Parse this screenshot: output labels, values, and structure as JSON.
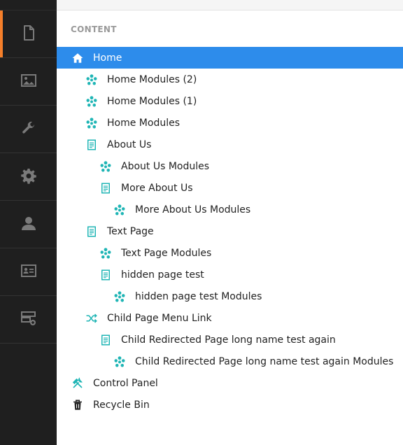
{
  "sidebar": {
    "items": [
      {
        "icon": "document-icon",
        "active": true
      },
      {
        "icon": "image-icon",
        "active": false
      },
      {
        "icon": "wrench-icon",
        "active": false
      },
      {
        "icon": "gear-icon",
        "active": false
      },
      {
        "icon": "user-icon",
        "active": false
      },
      {
        "icon": "contact-card-icon",
        "active": false
      },
      {
        "icon": "server-add-icon",
        "active": false
      }
    ]
  },
  "content": {
    "header": "CONTENT",
    "tree": [
      {
        "label": "Home",
        "icon": "home-icon",
        "depth": 0,
        "selected": true
      },
      {
        "label": "Home Modules (2)",
        "icon": "modules-icon",
        "depth": 1
      },
      {
        "label": "Home Modules (1)",
        "icon": "modules-icon",
        "depth": 1
      },
      {
        "label": "Home Modules",
        "icon": "modules-icon",
        "depth": 1
      },
      {
        "label": "About Us",
        "icon": "page-icon",
        "depth": 1
      },
      {
        "label": "About Us Modules",
        "icon": "modules-icon",
        "depth": 2
      },
      {
        "label": "More About Us",
        "icon": "page-icon",
        "depth": 2
      },
      {
        "label": "More About Us Modules",
        "icon": "modules-icon",
        "depth": 3
      },
      {
        "label": "Text Page",
        "icon": "page-icon",
        "depth": 1
      },
      {
        "label": "Text Page Modules",
        "icon": "modules-icon",
        "depth": 2
      },
      {
        "label": "hidden page test",
        "icon": "page-icon",
        "depth": 2
      },
      {
        "label": "hidden page test Modules",
        "icon": "modules-icon",
        "depth": 3
      },
      {
        "label": "Child Page Menu Link",
        "icon": "redirect-icon",
        "depth": 1
      },
      {
        "label": "Child Redirected Page long name test again",
        "icon": "page-icon",
        "depth": 2
      },
      {
        "label": "Child Redirected Page long name test again Modules",
        "icon": "modules-icon",
        "depth": 3
      },
      {
        "label": "Control Panel",
        "icon": "tools-icon",
        "depth": 0
      },
      {
        "label": "Recycle Bin",
        "icon": "trash-icon",
        "depth": 0
      }
    ]
  },
  "colors": {
    "sidebar_bg": "#1f1f1f",
    "sidebar_active_accent": "#f57f2a",
    "selection_bg": "#2d8ceb",
    "module_icon": "#1fb5b5"
  }
}
